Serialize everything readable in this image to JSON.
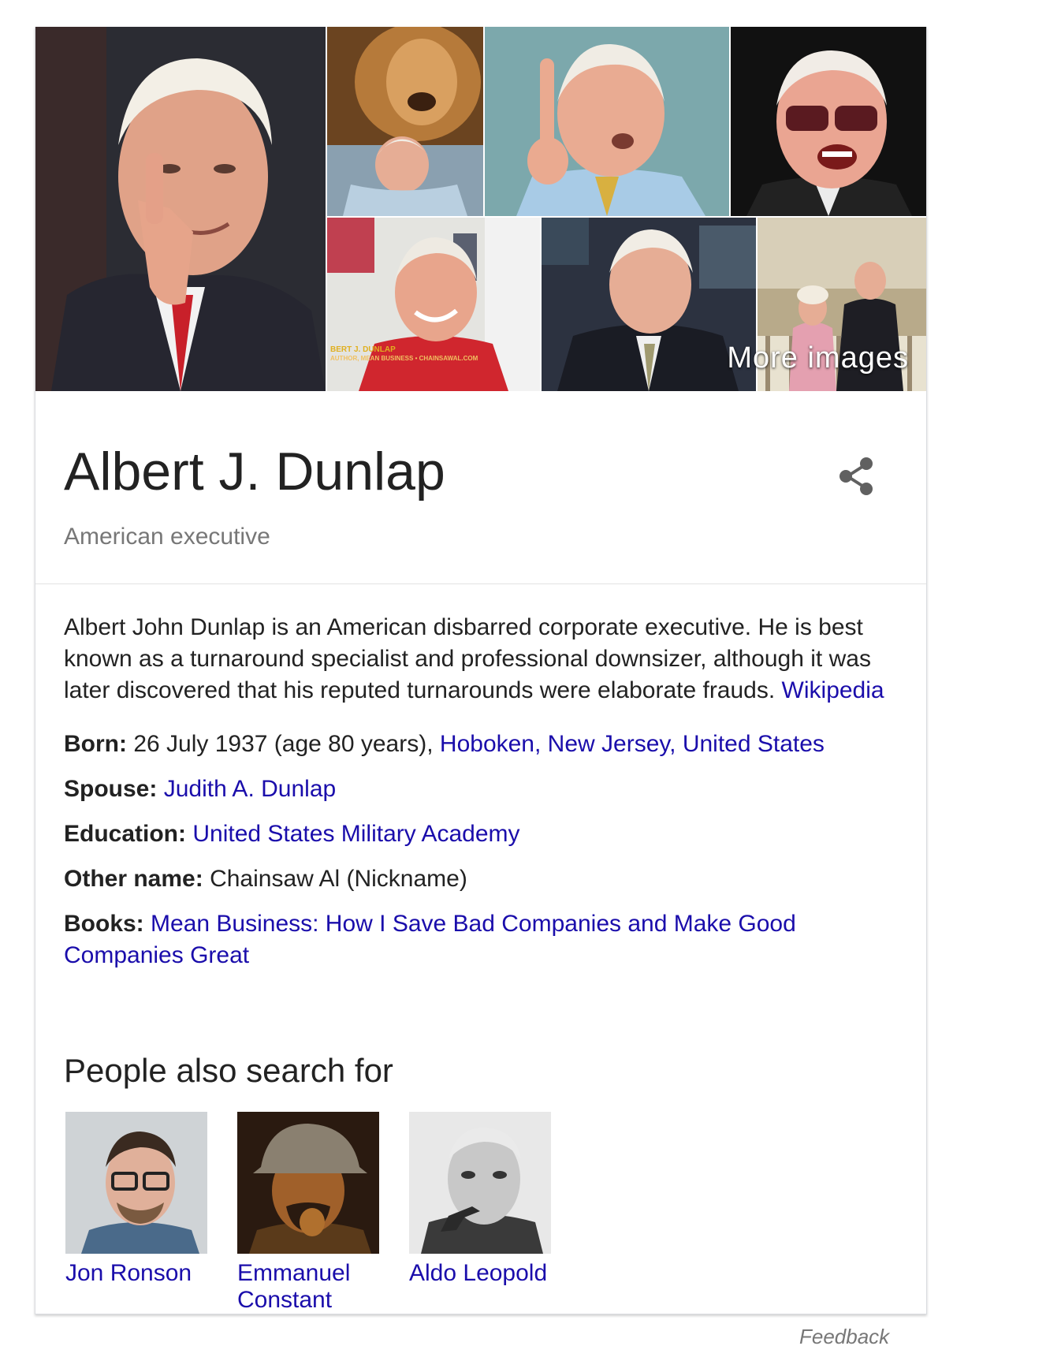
{
  "mosaic": {
    "more_images_label": "More images",
    "tiles": [
      {
        "name": "main-portrait",
        "bg": "#2a2a2e",
        "skin": "#e8a890",
        "hair": "#f0ece4"
      },
      {
        "name": "lion-photo",
        "bg": "#8a5a2a"
      },
      {
        "name": "finger-up-photo",
        "bg": "#7aa4a8"
      },
      {
        "name": "sunglasses-photo",
        "bg": "#1a1a1a"
      },
      {
        "name": "red-shirt-photo",
        "bg": "#ddd"
      },
      {
        "name": "tv-interview-photo",
        "bg": "#2a3040"
      },
      {
        "name": "couple-photo",
        "bg": "#b0a080"
      }
    ],
    "caption_text": "BERT J. DUNLAP",
    "caption_sub": "AUTHOR, MEAN BUSINESS • CHAINSAWAL.COM"
  },
  "header": {
    "title": "Albert J. Dunlap",
    "subtitle": "American executive",
    "share_icon": "share-icon"
  },
  "description": {
    "text": "Albert John Dunlap is an American disbarred corporate executive. He is best known as a turnaround specialist and professional downsizer, although it was later discovered that his reputed turnarounds were elaborate frauds.",
    "source_link": "Wikipedia"
  },
  "facts": {
    "born": {
      "label": "Born:",
      "value": "26 July 1937 (age 80 years),",
      "link": "Hoboken, New Jersey, United States"
    },
    "spouse": {
      "label": "Spouse:",
      "link": "Judith A. Dunlap"
    },
    "education": {
      "label": "Education:",
      "link": "United States Military Academy"
    },
    "other_name": {
      "label": "Other name:",
      "value": "Chainsaw Al (Nickname)"
    },
    "books": {
      "label": "Books:",
      "link": "Mean Business: How I Save Bad Companies and Make Good Companies Great"
    }
  },
  "people_also_search": {
    "title": "People also search for",
    "people": [
      {
        "name": "Jon Ronson"
      },
      {
        "name": "Emmanuel Constant"
      },
      {
        "name": "Aldo Leopold"
      }
    ]
  },
  "footer": {
    "feedback_label": "Feedback"
  }
}
